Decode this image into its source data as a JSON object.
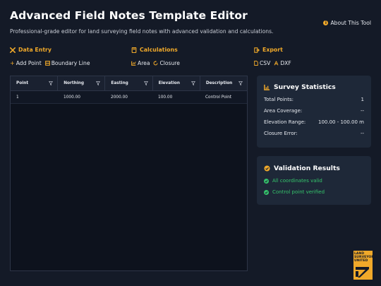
{
  "header": {
    "title": "Advanced Field Notes Template Editor",
    "subtitle": "Professional-grade editor for land surveying field notes with advanced validation and calculations.",
    "about_label": "About This Tool"
  },
  "sections": {
    "data_entry": {
      "title": "Data Entry",
      "add_point": "Add Point",
      "boundary_line": "Boundary Line"
    },
    "calculations": {
      "title": "Calculations",
      "area": "Area",
      "closure": "Closure"
    },
    "export": {
      "title": "Export",
      "csv": "CSV",
      "dxf": "DXF"
    }
  },
  "table": {
    "columns": [
      "Point",
      "Northing",
      "Easting",
      "Elevation",
      "Description"
    ],
    "rows": [
      [
        "1",
        "1000.00",
        "2000.00",
        "100.00",
        "Control Point"
      ]
    ]
  },
  "stats": {
    "title": "Survey Statistics",
    "items": [
      {
        "label": "Total Points:",
        "value": "1"
      },
      {
        "label": "Area Coverage:",
        "value": "--"
      },
      {
        "label": "Elevation Range:",
        "value": "100.00 - 100.00 m"
      },
      {
        "label": "Closure Error:",
        "value": "--"
      }
    ]
  },
  "validation": {
    "title": "Validation Results",
    "items": [
      "All coordinates valid",
      "Control point verified"
    ]
  },
  "logo": {
    "line1": "LAND",
    "line2": "SURVEYORS",
    "line3": "UNITED"
  },
  "colors": {
    "accent": "#f0a92a",
    "success": "#35c36b",
    "background": "#141a27",
    "card": "#1e2838"
  }
}
